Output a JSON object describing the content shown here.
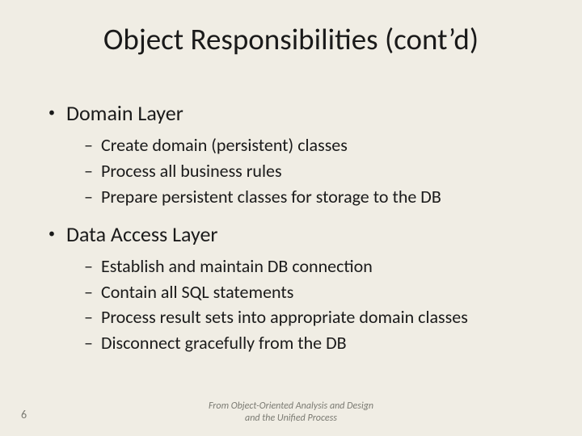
{
  "title": "Object Responsibilities (cont’d)",
  "sections": [
    {
      "heading": "Domain Layer",
      "items": [
        "Create domain (persistent) classes",
        "Process all business rules",
        "Prepare persistent classes for storage to the DB"
      ]
    },
    {
      "heading": "Data Access Layer",
      "items": [
        "Establish and maintain DB connection",
        "Contain all SQL statements",
        "Process result sets into appropriate domain classes",
        "Disconnect gracefully from the DB"
      ]
    }
  ],
  "page_number": "6",
  "attribution_line1": "From Object-Oriented Analysis and Design",
  "attribution_line2": "and the Unified Process"
}
